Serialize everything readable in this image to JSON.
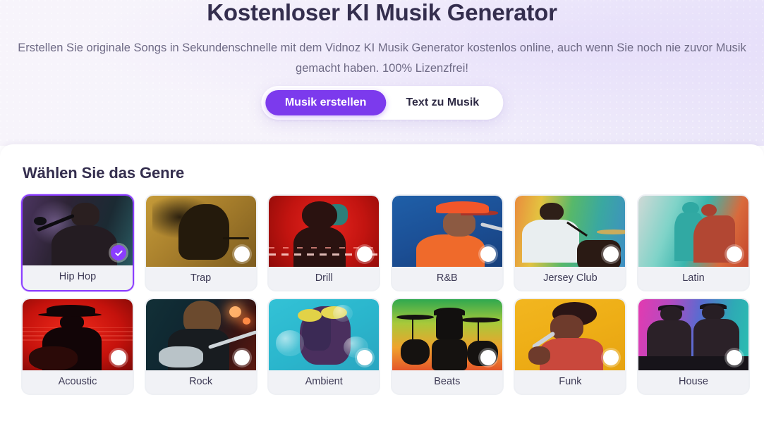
{
  "hero": {
    "title": "Kostenloser KI Musik Generator",
    "subtitle": "Erstellen Sie originale Songs in Sekundenschnelle mit dem Vidnoz KI Musik Generator kostenlos online, auch wenn Sie noch nie zuvor Musik gemacht haben. 100% Lizenzfrei!"
  },
  "tabs": {
    "active_index": 0,
    "items": [
      {
        "label": "Musik erstellen",
        "active": true
      },
      {
        "label": "Text zu Musik",
        "active": false
      }
    ]
  },
  "genre_section": {
    "heading": "Wählen Sie das Genre",
    "selected_genre": "Hip Hop",
    "checked_icon": "check-icon",
    "unchecked_icon": "radio-unchecked-icon",
    "items": [
      {
        "label": "Hip Hop",
        "selected": true
      },
      {
        "label": "Trap",
        "selected": false
      },
      {
        "label": "Drill",
        "selected": false
      },
      {
        "label": "R&B",
        "selected": false
      },
      {
        "label": "Jersey Club",
        "selected": false
      },
      {
        "label": "Latin",
        "selected": false
      },
      {
        "label": "Acoustic",
        "selected": false
      },
      {
        "label": "Rock",
        "selected": false
      },
      {
        "label": "Ambient",
        "selected": false
      },
      {
        "label": "Beats",
        "selected": false
      },
      {
        "label": "Funk",
        "selected": false
      },
      {
        "label": "House",
        "selected": false
      }
    ]
  },
  "colors": {
    "accent_purple": "#7c3aed",
    "selected_border": "#8b3dff",
    "title_ink": "#342e4e",
    "body_ink": "#6e6a85",
    "label_strip": "#f1f2f6",
    "hero_bg": "#f5f2fb",
    "panel_bg": "#ffffff"
  }
}
